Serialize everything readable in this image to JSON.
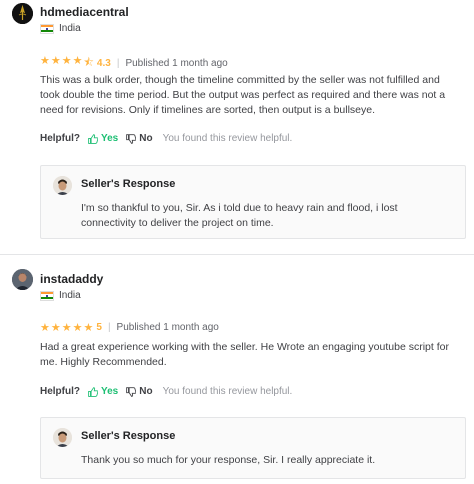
{
  "reviews": [
    {
      "username": "hdmediacentral",
      "country": "India",
      "rating": 4.3,
      "rating_text": "4.3",
      "stars": [
        "★",
        "★",
        "★",
        "★",
        "⯪"
      ],
      "published": "Published 1 month ago",
      "text": "This was a bulk order, though the timeline committed by the seller was not fulfilled and took double the time period. But the output was perfect as required and there was not a need for revisions. Only if timelines are sorted, then output is a bullseye.",
      "helpful_label": "Helpful?",
      "yes_label": "Yes",
      "no_label": "No",
      "found_text": "You found this review helpful.",
      "response_title": "Seller's Response",
      "response_text": "I'm so thankful to you, Sir. As i told due to heavy rain and flood, i lost connectivity to deliver the project on time."
    },
    {
      "username": "instadaddy",
      "country": "India",
      "rating": 5,
      "rating_text": "5",
      "stars": [
        "★",
        "★",
        "★",
        "★",
        "★"
      ],
      "published": "Published 1 month ago",
      "text": "Had a great experience working with the seller. He Wrote an engaging youtube script for me. Highly Recommended.",
      "helpful_label": "Helpful?",
      "yes_label": "Yes",
      "no_label": "No",
      "found_text": "You found this review helpful.",
      "response_title": "Seller's Response",
      "response_text": "Thank you so much for your response, Sir. I really appreciate it."
    }
  ],
  "colors": {
    "star": "#ffb33e",
    "yes_green": "#1dbf73",
    "text": "#404145",
    "muted": "#95979d"
  },
  "icons": {
    "thumbs_up": "thumbs-up-icon",
    "thumbs_down": "thumbs-down-icon"
  }
}
